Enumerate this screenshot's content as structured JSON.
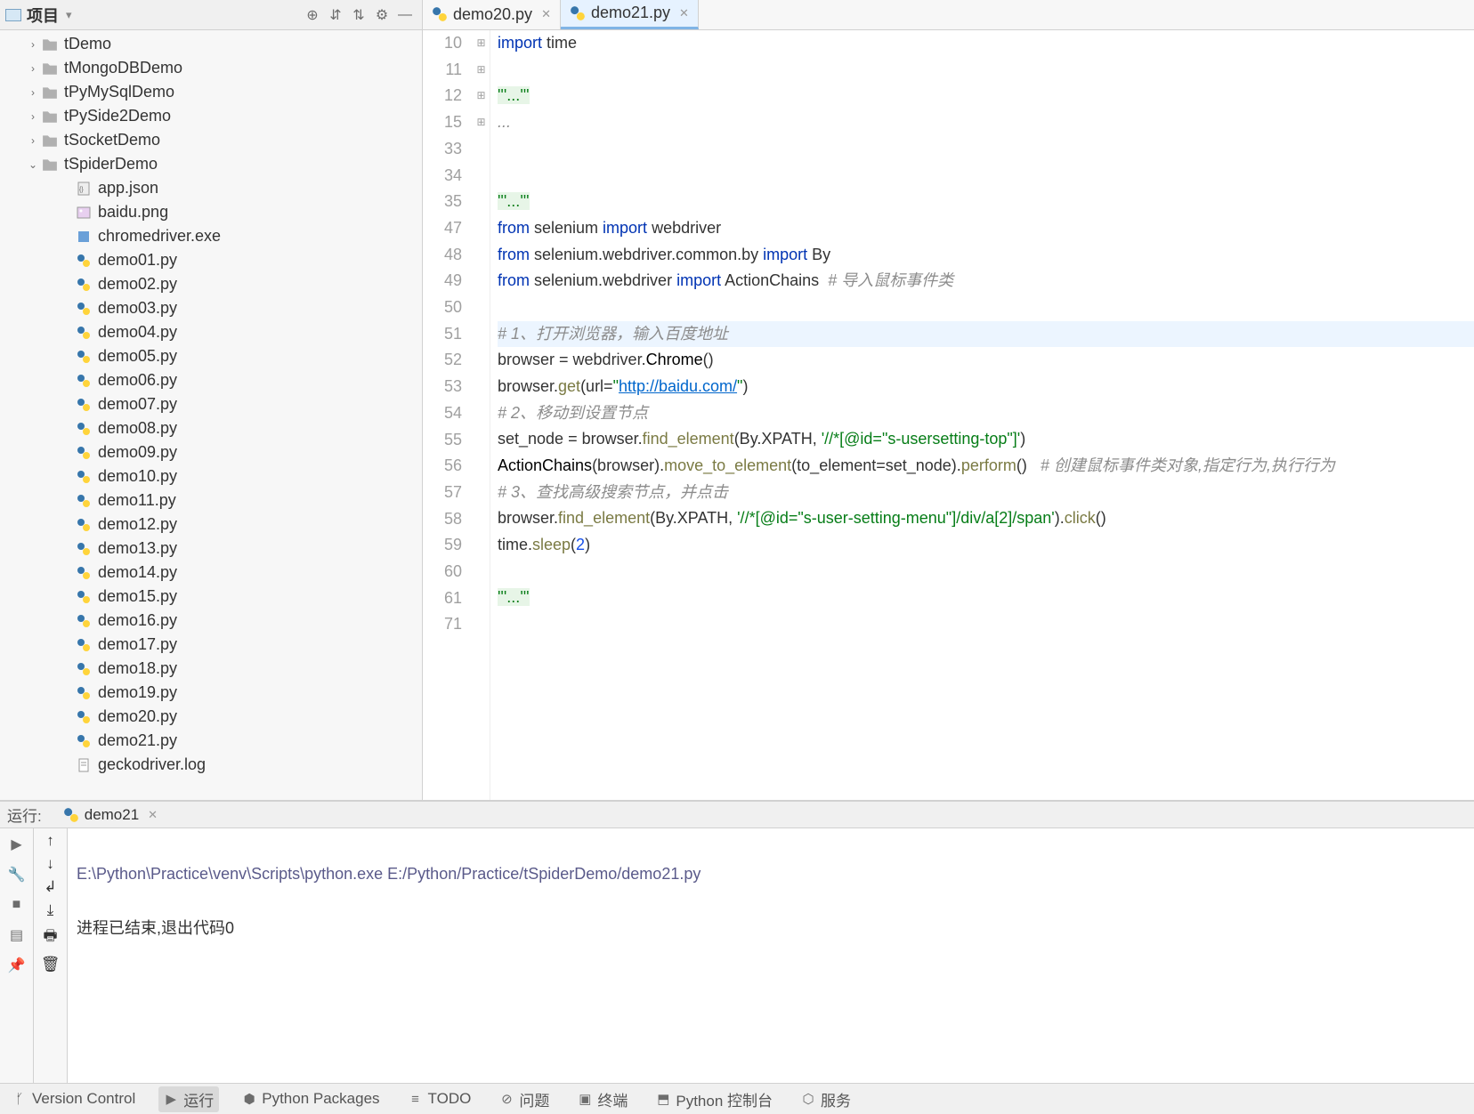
{
  "project_panel": {
    "title": "项目",
    "folders": [
      {
        "label": "tDemo",
        "expanded": false,
        "depth": 0
      },
      {
        "label": "tMongoDBDemo",
        "expanded": false,
        "depth": 0
      },
      {
        "label": "tPyMySqlDemo",
        "expanded": false,
        "depth": 0
      },
      {
        "label": "tPySide2Demo",
        "expanded": false,
        "depth": 0
      },
      {
        "label": "tSocketDemo",
        "expanded": false,
        "depth": 0
      },
      {
        "label": "tSpiderDemo",
        "expanded": true,
        "depth": 0
      }
    ],
    "files": [
      {
        "label": "app.json",
        "type": "json"
      },
      {
        "label": "baidu.png",
        "type": "img"
      },
      {
        "label": "chromedriver.exe",
        "type": "exe"
      },
      {
        "label": "demo01.py",
        "type": "py"
      },
      {
        "label": "demo02.py",
        "type": "py"
      },
      {
        "label": "demo03.py",
        "type": "py"
      },
      {
        "label": "demo04.py",
        "type": "py"
      },
      {
        "label": "demo05.py",
        "type": "py"
      },
      {
        "label": "demo06.py",
        "type": "py"
      },
      {
        "label": "demo07.py",
        "type": "py"
      },
      {
        "label": "demo08.py",
        "type": "py"
      },
      {
        "label": "demo09.py",
        "type": "py"
      },
      {
        "label": "demo10.py",
        "type": "py"
      },
      {
        "label": "demo11.py",
        "type": "py"
      },
      {
        "label": "demo12.py",
        "type": "py"
      },
      {
        "label": "demo13.py",
        "type": "py"
      },
      {
        "label": "demo14.py",
        "type": "py"
      },
      {
        "label": "demo15.py",
        "type": "py"
      },
      {
        "label": "demo16.py",
        "type": "py"
      },
      {
        "label": "demo17.py",
        "type": "py"
      },
      {
        "label": "demo18.py",
        "type": "py"
      },
      {
        "label": "demo19.py",
        "type": "py"
      },
      {
        "label": "demo20.py",
        "type": "py"
      },
      {
        "label": "demo21.py",
        "type": "py"
      },
      {
        "label": "geckodriver.log",
        "type": "log"
      }
    ]
  },
  "tabs": [
    {
      "label": "demo20.py",
      "active": false
    },
    {
      "label": "demo21.py",
      "active": true
    }
  ],
  "code": {
    "lines": [
      {
        "num": "10",
        "tokens": [
          {
            "t": "import",
            "c": "kw2"
          },
          {
            "t": " time",
            "c": ""
          }
        ]
      },
      {
        "num": "11",
        "tokens": []
      },
      {
        "num": "12",
        "fold": "⊞",
        "tokens": [
          {
            "t": "'''...'''",
            "c": "str str-bg"
          }
        ]
      },
      {
        "num": "15",
        "fold": "⊞",
        "tokens": [
          {
            "t": "...",
            "c": "comment"
          }
        ]
      },
      {
        "num": "33",
        "tokens": []
      },
      {
        "num": "34",
        "tokens": []
      },
      {
        "num": "35",
        "fold": "⊞",
        "tokens": [
          {
            "t": "'''...'''",
            "c": "str str-bg"
          }
        ]
      },
      {
        "num": "47",
        "tokens": [
          {
            "t": "from",
            "c": "kw2"
          },
          {
            "t": " selenium ",
            "c": ""
          },
          {
            "t": "import",
            "c": "kw2"
          },
          {
            "t": " webdriver",
            "c": ""
          }
        ]
      },
      {
        "num": "48",
        "tokens": [
          {
            "t": "from",
            "c": "kw2"
          },
          {
            "t": " selenium.webdriver.common.by ",
            "c": ""
          },
          {
            "t": "import",
            "c": "kw2"
          },
          {
            "t": " By",
            "c": ""
          }
        ]
      },
      {
        "num": "49",
        "tokens": [
          {
            "t": "from",
            "c": "kw2"
          },
          {
            "t": " selenium.webdriver ",
            "c": ""
          },
          {
            "t": "import",
            "c": "kw2"
          },
          {
            "t": " ActionChains  ",
            "c": ""
          },
          {
            "t": "# 导入鼠标事件类",
            "c": "comment"
          }
        ]
      },
      {
        "num": "50",
        "tokens": []
      },
      {
        "num": "51",
        "hl": true,
        "tokens": [
          {
            "t": "# 1、打开浏览器，输入百度地址",
            "c": "comment"
          }
        ]
      },
      {
        "num": "52",
        "tokens": [
          {
            "t": "browser = webdriver.",
            "c": ""
          },
          {
            "t": "Chrome",
            "c": "cls"
          },
          {
            "t": "()",
            "c": ""
          }
        ]
      },
      {
        "num": "53",
        "tokens": [
          {
            "t": "browser.",
            "c": ""
          },
          {
            "t": "get",
            "c": "fn"
          },
          {
            "t": "(",
            "c": ""
          },
          {
            "t": "url",
            "c": ""
          },
          {
            "t": "=",
            "c": ""
          },
          {
            "t": "\"",
            "c": "str"
          },
          {
            "t": "http://baidu.com/",
            "c": "url"
          },
          {
            "t": "\"",
            "c": "str"
          },
          {
            "t": ")",
            "c": ""
          }
        ]
      },
      {
        "num": "54",
        "tokens": [
          {
            "t": "# 2、移动到设置节点",
            "c": "comment"
          }
        ]
      },
      {
        "num": "55",
        "tokens": [
          {
            "t": "set_node = browser.",
            "c": ""
          },
          {
            "t": "find_element",
            "c": "fn"
          },
          {
            "t": "(By.XPATH, ",
            "c": ""
          },
          {
            "t": "'//*[@id=\"s-usersetting-top\"]'",
            "c": "str"
          },
          {
            "t": ")",
            "c": ""
          }
        ]
      },
      {
        "num": "56",
        "tokens": [
          {
            "t": "ActionChains",
            "c": "cls"
          },
          {
            "t": "(browser).",
            "c": ""
          },
          {
            "t": "move_to_element",
            "c": "fn"
          },
          {
            "t": "(",
            "c": ""
          },
          {
            "t": "to_element",
            "c": ""
          },
          {
            "t": "=set_node).",
            "c": ""
          },
          {
            "t": "perform",
            "c": "fn"
          },
          {
            "t": "()   ",
            "c": ""
          },
          {
            "t": "# 创建鼠标事件类对象,指定行为,执行行为",
            "c": "comment"
          }
        ]
      },
      {
        "num": "57",
        "tokens": [
          {
            "t": "# 3、查找高级搜索节点，并点击",
            "c": "comment"
          }
        ]
      },
      {
        "num": "58",
        "tokens": [
          {
            "t": "browser.",
            "c": ""
          },
          {
            "t": "find_element",
            "c": "fn"
          },
          {
            "t": "(By.XPATH, ",
            "c": ""
          },
          {
            "t": "'//*[@id=\"s-user-setting-menu\"]/div/a[2]/span'",
            "c": "str"
          },
          {
            "t": ").",
            "c": ""
          },
          {
            "t": "click",
            "c": "fn"
          },
          {
            "t": "()",
            "c": ""
          }
        ]
      },
      {
        "num": "59",
        "tokens": [
          {
            "t": "time.",
            "c": ""
          },
          {
            "t": "sleep",
            "c": "fn"
          },
          {
            "t": "(",
            "c": ""
          },
          {
            "t": "2",
            "c": "num"
          },
          {
            "t": ")",
            "c": ""
          }
        ]
      },
      {
        "num": "60",
        "tokens": []
      },
      {
        "num": "61",
        "fold": "⊞",
        "tokens": [
          {
            "t": "'''...'''",
            "c": "str str-bg"
          }
        ]
      },
      {
        "num": "71",
        "tokens": []
      }
    ]
  },
  "run": {
    "label": "运行:",
    "tab_name": "demo21",
    "output_path": "E:\\Python\\Practice\\venv\\Scripts\\python.exe E:/Python/Practice/tSpiderDemo/demo21.py",
    "output_exit": "进程已结束,退出代码0"
  },
  "bottom_bar": {
    "items": [
      {
        "label": "Version Control",
        "icon": "branch"
      },
      {
        "label": "运行",
        "icon": "play",
        "active": true
      },
      {
        "label": "Python Packages",
        "icon": "packages"
      },
      {
        "label": "TODO",
        "icon": "todo"
      },
      {
        "label": "问题",
        "icon": "problems"
      },
      {
        "label": "终端",
        "icon": "terminal"
      },
      {
        "label": "Python 控制台",
        "icon": "console"
      },
      {
        "label": "服务",
        "icon": "services"
      }
    ]
  }
}
